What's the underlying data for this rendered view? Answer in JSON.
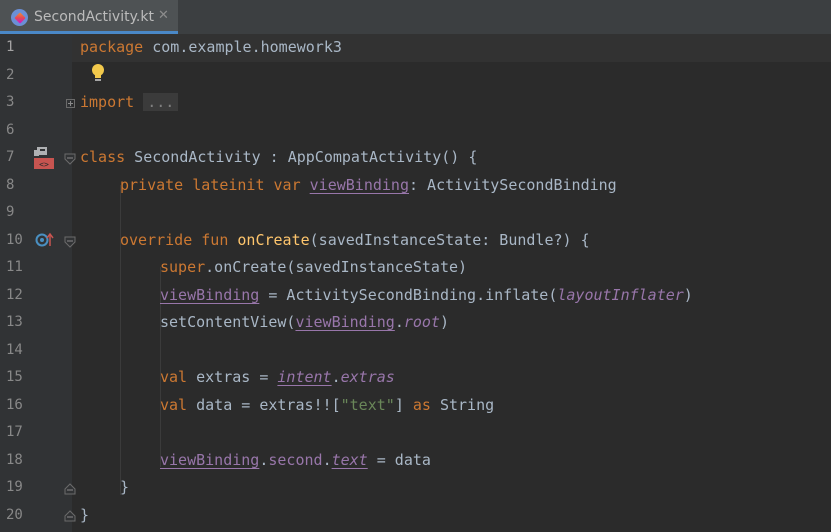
{
  "tab": {
    "filename": "SecondActivity.kt",
    "close_glyph": "✕",
    "icon": "kotlin-file-icon"
  },
  "editor": {
    "line_numbers": [
      "1",
      "2",
      "3",
      "6",
      "7",
      "8",
      "9",
      "10",
      "11",
      "12",
      "13",
      "14",
      "15",
      "16",
      "17",
      "18",
      "19",
      "20"
    ],
    "code": {
      "l1_package_kw": "package",
      "l1_package_name": " com.example.homework3",
      "l3_import_kw": "import",
      "l3_folded": "...",
      "l7_class_kw": "class",
      "l7_rest": " SecondActivity : AppCompatActivity() {",
      "l8_modifiers": "private lateinit var",
      "l8_prop": "viewBinding",
      "l8_type": ": ActivitySecondBinding",
      "l10_modifiers": "override fun",
      "l10_fn": "onCreate",
      "l10_params": "(savedInstanceState: Bundle?) {",
      "l11_super": "super",
      "l11_rest": ".onCreate(savedInstanceState)",
      "l12_prop": "viewBinding",
      "l12_mid": " = ActivitySecondBinding.inflate(",
      "l12_arg": "layoutInflater",
      "l12_end": ")",
      "l13_call": "setContentView(",
      "l13_prop": "viewBinding",
      "l13_dot": ".",
      "l13_root": "root",
      "l13_end": ")",
      "l15_val": "val",
      "l15_mid": " extras = ",
      "l15_intent": "intent",
      "l15_dot": ".",
      "l15_extras": "extras",
      "l16_val": "val",
      "l16_mid": " data = extras!![",
      "l16_str": "\"text\"",
      "l16_close": "] ",
      "l16_as": "as",
      "l16_type": " String",
      "l18_prop": "viewBinding",
      "l18_dot1": ".",
      "l18_second": "second",
      "l18_dot2": ".",
      "l18_text": "text",
      "l18_rest": " = data",
      "l19_brace": "}",
      "l20_brace": "}"
    },
    "gutter_icons": {
      "line7": "activity-layout-icon",
      "line10": "override-method-icon",
      "line2": "lightbulb-icon"
    },
    "colors": {
      "background": "#2b2b2b",
      "keyword": "#cc7832",
      "function": "#ffc66d",
      "property": "#9876aa",
      "string": "#6a8759",
      "text": "#a9b7c6"
    }
  }
}
